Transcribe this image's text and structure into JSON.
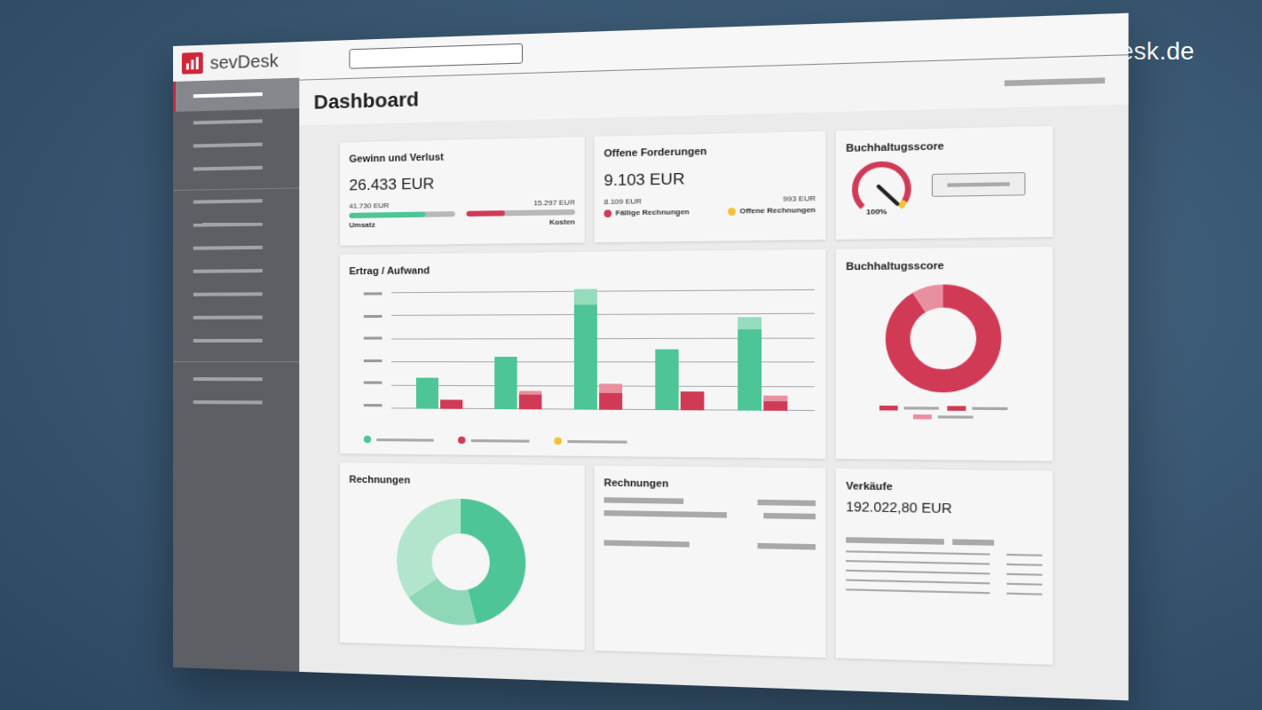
{
  "watermark": "sevDesk.de",
  "app": {
    "logo": "sevDesk",
    "sidebar": {
      "groups": [
        [
          {
            "selected": true
          },
          {
            "selected": false
          },
          {
            "selected": false
          },
          {
            "selected": false
          }
        ],
        [
          {
            "selected": false
          },
          {
            "selected": false
          },
          {
            "selected": false
          },
          {
            "selected": false
          },
          {
            "selected": false
          },
          {
            "selected": false
          },
          {
            "selected": false
          }
        ],
        [
          {
            "selected": false
          },
          {
            "selected": false
          }
        ]
      ]
    },
    "page_title": "Dashboard",
    "profit_card": {
      "title": "Gewinn und Verlust",
      "value": "26.433 EUR",
      "revenue": {
        "amount": "41.730 EUR",
        "label": "Umsatz",
        "level": 0.72,
        "color": "#4dc596"
      },
      "costs": {
        "amount": "15.297 EUR",
        "label": "Kosten",
        "level": 0.36,
        "color": "#d13a55"
      }
    },
    "receivables_card": {
      "title": "Offene Forderungen",
      "value": "9.103 EUR",
      "items": [
        {
          "amount": "8.109 EUR",
          "label": "Fällige Rechnungen",
          "color": "#d13a55"
        },
        {
          "amount": "993 EUR",
          "label": "Offene Rechnungen",
          "color": "#f2c230"
        }
      ]
    },
    "score_gauge": {
      "title": "Buchhaltugsscore",
      "reading": "100%",
      "level": 1.0
    },
    "chart": {
      "title": "Ertrag / Aufwand",
      "series": [
        {
          "stack": "ertrag",
          "color": "#4dc596",
          "values": [
            1.6,
            2.7,
            5.4,
            3.1,
            4.1
          ]
        },
        {
          "stack": "ertrag",
          "color": "#95dcbd",
          "values": [
            0,
            0,
            0.8,
            0,
            0.6
          ]
        },
        {
          "stack": "aufwand",
          "color": "#d13a55",
          "values": [
            0.5,
            0.75,
            0.85,
            0.95,
            0.5
          ]
        },
        {
          "stack": "aufwand",
          "color": "#e8909f",
          "values": [
            0,
            0.2,
            0.5,
            0,
            0.25
          ]
        }
      ],
      "legend": [
        {
          "color": "#4dc596"
        },
        {
          "color": "#d13a55"
        },
        {
          "color": "#f2c230"
        }
      ]
    },
    "score_donut": {
      "title": "Buchhaltugsscore",
      "segments": [
        {
          "value": 0.91,
          "color": "#d13a55"
        },
        {
          "value": 0.09,
          "color": "#e8909f"
        }
      ],
      "legend": [
        {
          "color": "#d13a55"
        },
        {
          "color": "#d13a55"
        },
        {
          "color": "#e8909f"
        }
      ]
    },
    "invoices_donut": {
      "title": "Rechnungen",
      "segments": [
        {
          "value": 0.46,
          "color": "#4dc596"
        },
        {
          "value": 0.19,
          "color": "#8fd8b7"
        },
        {
          "value": 0.35,
          "color": "#b3e5cd"
        }
      ]
    },
    "invoices_list": {
      "title": "Rechnungen"
    },
    "sales_card": {
      "title": "Verkäufe",
      "value": "192.022,80 EUR"
    }
  }
}
